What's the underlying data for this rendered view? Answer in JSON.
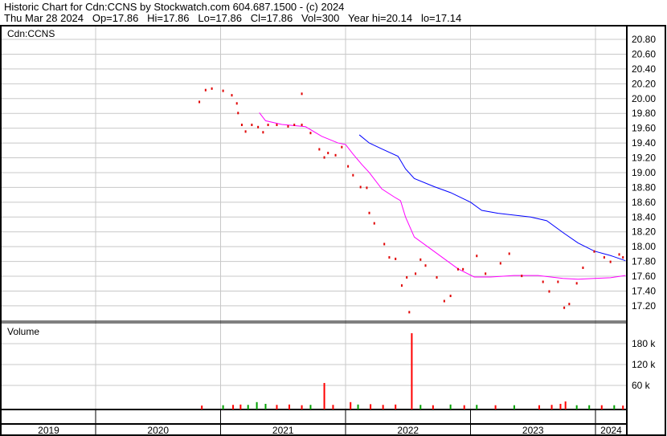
{
  "header": {
    "line1": "Historic Chart for Cdn:CCNS by Stockwatch.com 604.687.1500 - (c) 2024",
    "line2": "Thu Mar 28 2024   Op=17.86   Hi=17.86   Lo=17.86   Cl=17.86   Vol=300   Year hi=20.14   lo=17.14"
  },
  "chart_data": {
    "type": "scatter",
    "symbol_label": "Cdn:CCNS",
    "volume_label": "Volume",
    "price_ylim": [
      17.0,
      21.0
    ],
    "price_ticks": [
      "20.80",
      "20.60",
      "20.40",
      "20.20",
      "20.00",
      "19.80",
      "19.60",
      "19.40",
      "19.20",
      "19.00",
      "18.80",
      "18.60",
      "18.40",
      "18.20",
      "18.00",
      "17.80",
      "17.60",
      "17.40",
      "17.20"
    ],
    "volume_ticks": [
      {
        "v": 180000,
        "label": "180 k"
      },
      {
        "v": 120000,
        "label": "120 k"
      },
      {
        "v": 60000,
        "label": "60 k"
      }
    ],
    "years": [
      "2019",
      "2020",
      "2021",
      "2022",
      "2023",
      "2024"
    ],
    "xlim": [
      2019.24,
      2024.26
    ],
    "colors": {
      "price": "#e00000",
      "ma_short": "#ff00ff",
      "ma_long": "#0000ff",
      "vol_up": "#00a000",
      "vol_down": "#ff0000",
      "grid": "#c8c8c8"
    },
    "price_points": [
      [
        2020.83,
        19.96
      ],
      [
        2020.88,
        20.12
      ],
      [
        2020.93,
        20.14
      ],
      [
        2021.02,
        20.11
      ],
      [
        2021.09,
        20.05
      ],
      [
        2021.13,
        19.94
      ],
      [
        2021.14,
        19.81
      ],
      [
        2021.17,
        19.65
      ],
      [
        2021.2,
        19.56
      ],
      [
        2021.25,
        19.65
      ],
      [
        2021.3,
        19.62
      ],
      [
        2021.34,
        19.55
      ],
      [
        2021.38,
        19.65
      ],
      [
        2021.45,
        19.65
      ],
      [
        2021.54,
        19.63
      ],
      [
        2021.59,
        19.65
      ],
      [
        2021.65,
        19.65
      ],
      [
        2021.65,
        20.07
      ],
      [
        2021.72,
        19.54
      ],
      [
        2021.79,
        19.32
      ],
      [
        2021.83,
        19.21
      ],
      [
        2021.86,
        19.27
      ],
      [
        2021.92,
        19.24
      ],
      [
        2021.97,
        19.35
      ],
      [
        2022.02,
        19.09
      ],
      [
        2022.06,
        18.97
      ],
      [
        2022.12,
        18.81
      ],
      [
        2022.17,
        18.8
      ],
      [
        2022.19,
        18.46
      ],
      [
        2022.23,
        18.32
      ],
      [
        2022.31,
        18.04
      ],
      [
        2022.35,
        17.86
      ],
      [
        2022.4,
        17.84
      ],
      [
        2022.45,
        17.48
      ],
      [
        2022.49,
        17.59
      ],
      [
        2022.51,
        17.12
      ],
      [
        2022.56,
        17.64
      ],
      [
        2022.6,
        17.83
      ],
      [
        2022.64,
        17.75
      ],
      [
        2022.73,
        17.59
      ],
      [
        2022.79,
        17.27
      ],
      [
        2022.84,
        17.34
      ],
      [
        2022.9,
        17.7
      ],
      [
        2022.94,
        17.7
      ],
      [
        2023.05,
        17.88
      ],
      [
        2023.12,
        17.64
      ],
      [
        2023.24,
        17.78
      ],
      [
        2023.31,
        17.91
      ],
      [
        2023.41,
        17.61
      ],
      [
        2023.58,
        17.53
      ],
      [
        2023.63,
        17.4
      ],
      [
        2023.7,
        17.53
      ],
      [
        2023.75,
        17.18
      ],
      [
        2023.79,
        17.23
      ],
      [
        2023.85,
        17.51
      ],
      [
        2023.9,
        17.72
      ],
      [
        2023.99,
        17.94
      ],
      [
        2024.07,
        17.86
      ],
      [
        2024.12,
        17.8
      ],
      [
        2024.19,
        17.9
      ],
      [
        2024.22,
        17.86
      ]
    ],
    "ma_short": [
      [
        2021.31,
        19.81
      ],
      [
        2021.36,
        19.7
      ],
      [
        2021.49,
        19.65
      ],
      [
        2021.68,
        19.62
      ],
      [
        2021.81,
        19.49
      ],
      [
        2021.94,
        19.4
      ],
      [
        2022.0,
        19.38
      ],
      [
        2022.06,
        19.25
      ],
      [
        2022.13,
        19.11
      ],
      [
        2022.19,
        19.0
      ],
      [
        2022.29,
        18.78
      ],
      [
        2022.39,
        18.67
      ],
      [
        2022.44,
        18.62
      ],
      [
        2022.48,
        18.4
      ],
      [
        2022.55,
        18.13
      ],
      [
        2022.64,
        18.02
      ],
      [
        2022.77,
        17.86
      ],
      [
        2022.9,
        17.7
      ],
      [
        2023.03,
        17.59
      ],
      [
        2023.16,
        17.59
      ],
      [
        2023.35,
        17.61
      ],
      [
        2023.54,
        17.61
      ],
      [
        2023.74,
        17.57
      ],
      [
        2023.86,
        17.56
      ],
      [
        2023.99,
        17.57
      ],
      [
        2024.12,
        17.58
      ],
      [
        2024.24,
        17.61
      ]
    ],
    "ma_long": [
      [
        2022.11,
        19.51
      ],
      [
        2022.19,
        19.4
      ],
      [
        2022.29,
        19.32
      ],
      [
        2022.42,
        19.22
      ],
      [
        2022.48,
        19.05
      ],
      [
        2022.55,
        18.92
      ],
      [
        2022.71,
        18.81
      ],
      [
        2022.84,
        18.73
      ],
      [
        2023.0,
        18.6
      ],
      [
        2023.09,
        18.49
      ],
      [
        2023.22,
        18.45
      ],
      [
        2023.48,
        18.4
      ],
      [
        2023.61,
        18.35
      ],
      [
        2023.74,
        18.19
      ],
      [
        2023.86,
        18.05
      ],
      [
        2023.99,
        17.94
      ],
      [
        2024.12,
        17.88
      ],
      [
        2024.24,
        17.81
      ]
    ],
    "volume": [
      [
        2020.85,
        2000,
        "d"
      ],
      [
        2021.02,
        3000,
        "u"
      ],
      [
        2021.1,
        4000,
        "d"
      ],
      [
        2021.16,
        5000,
        "d"
      ],
      [
        2021.22,
        4000,
        "u"
      ],
      [
        2021.29,
        12000,
        "u"
      ],
      [
        2021.36,
        7000,
        "u"
      ],
      [
        2021.45,
        4000,
        "d"
      ],
      [
        2021.55,
        5000,
        "d"
      ],
      [
        2021.65,
        3000,
        "d"
      ],
      [
        2021.72,
        4000,
        "u"
      ],
      [
        2021.83,
        67000,
        "d"
      ],
      [
        2021.9,
        4000,
        "d"
      ],
      [
        2022.04,
        12000,
        "d"
      ],
      [
        2022.1,
        5000,
        "u"
      ],
      [
        2022.2,
        6000,
        "d"
      ],
      [
        2022.3,
        4000,
        "d"
      ],
      [
        2022.4,
        5000,
        "d"
      ],
      [
        2022.53,
        210000,
        "d"
      ],
      [
        2022.6,
        4000,
        "u"
      ],
      [
        2022.7,
        3000,
        "d"
      ],
      [
        2022.84,
        5000,
        "u"
      ],
      [
        2022.95,
        3000,
        "d"
      ],
      [
        2023.05,
        4000,
        "u"
      ],
      [
        2023.2,
        3000,
        "d"
      ],
      [
        2023.35,
        3000,
        "u"
      ],
      [
        2023.55,
        3000,
        "d"
      ],
      [
        2023.65,
        4000,
        "d"
      ],
      [
        2023.72,
        7000,
        "d"
      ],
      [
        2023.76,
        14000,
        "d"
      ],
      [
        2023.85,
        3000,
        "u"
      ],
      [
        2023.95,
        3000,
        "u"
      ],
      [
        2024.05,
        3000,
        "d"
      ],
      [
        2024.15,
        3000,
        "u"
      ],
      [
        2024.22,
        2000,
        "d"
      ]
    ]
  }
}
